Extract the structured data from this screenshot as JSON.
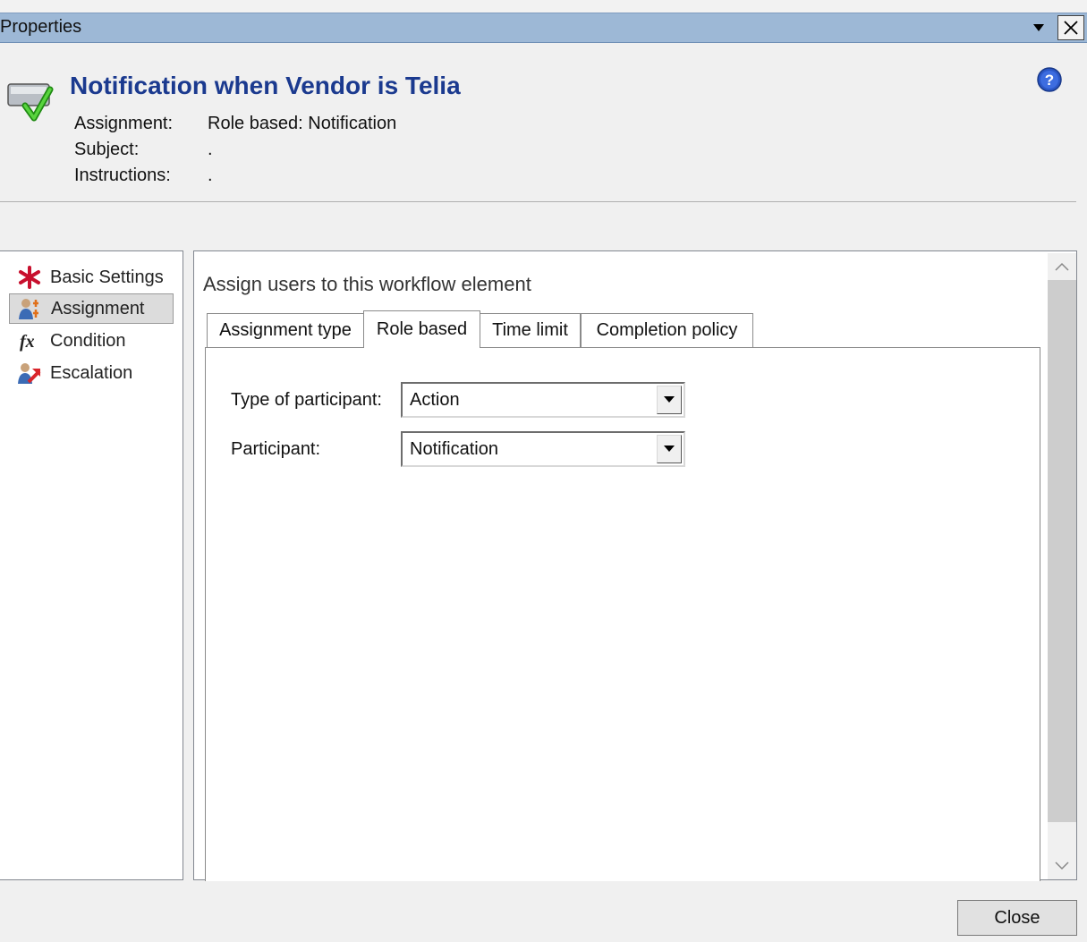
{
  "window": {
    "title": "Properties",
    "dropdown_icon": "dropdown-arrow-icon",
    "close_icon": "close-icon"
  },
  "header": {
    "element_title": "Notification when Vendor is Telia",
    "assignment_label": "Assignment:",
    "assignment_value": "Role based: Notification",
    "subject_label": "Subject:",
    "subject_value": ".",
    "instructions_label": "Instructions:",
    "instructions_value": ".",
    "help_icon": "help-icon"
  },
  "sidebar": {
    "items": [
      {
        "label": "Basic Settings",
        "icon": "asterisk-icon",
        "selected": false
      },
      {
        "label": "Assignment",
        "icon": "users-assignment-icon",
        "selected": true
      },
      {
        "label": "Condition",
        "icon": "function-fx-icon",
        "selected": false
      },
      {
        "label": "Escalation",
        "icon": "user-escalation-icon",
        "selected": false
      }
    ]
  },
  "main": {
    "heading": "Assign users to this workflow element",
    "tabs": [
      {
        "label": "Assignment type",
        "active": false
      },
      {
        "label": "Role based",
        "active": true
      },
      {
        "label": "Time limit",
        "active": false
      },
      {
        "label": "Completion policy",
        "active": false
      }
    ],
    "fields": {
      "type_of_participant_label": "Type of participant:",
      "type_of_participant_value": "Action",
      "participant_label": "Participant:",
      "participant_value": "Notification"
    }
  },
  "footer": {
    "close_label": "Close"
  },
  "colors": {
    "title_bar": "#9db8d6",
    "element_title": "#1b3a8f",
    "selected_nav": "#dcdcdc"
  }
}
